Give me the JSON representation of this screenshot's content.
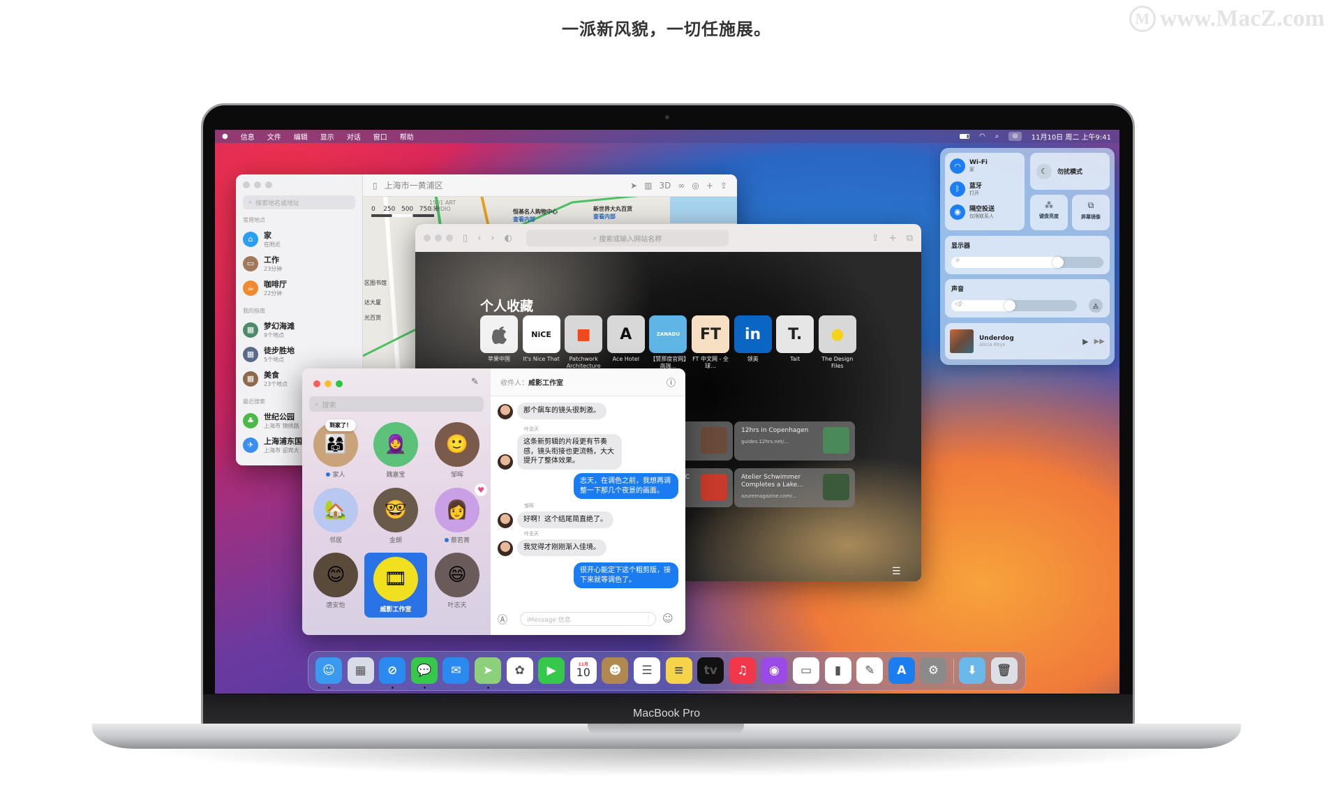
{
  "headline": "一派新风貌，一切任施展。",
  "watermark": "www.MacZ.com",
  "device_label": "MacBook Pro",
  "menubar": {
    "items": [
      "信息",
      "文件",
      "编辑",
      "显示",
      "对话",
      "窗口",
      "帮助"
    ],
    "datetime": "11月10日 周二 上午9:41"
  },
  "maps": {
    "search_placeholder": "搜索地名或地址",
    "location_title": "上海市一黄浦区",
    "toolbar_3d": "3D",
    "sections": [
      {
        "title": "常用地点",
        "items": [
          {
            "name": "家",
            "detail": "在附近",
            "color": "#2a9df4",
            "icon": "home-icon"
          },
          {
            "name": "工作",
            "detail": "23分钟",
            "color": "#a0785a",
            "icon": "briefcase-icon"
          },
          {
            "name": "咖啡厅",
            "detail": "22分钟",
            "color": "#f08a30",
            "icon": "coffee-icon"
          }
        ]
      },
      {
        "title": "我的指南",
        "items": [
          {
            "name": "梦幻海滩",
            "detail": "9个地点",
            "color": "#4c8a6a",
            "icon": "guide-icon"
          },
          {
            "name": "徒步胜地",
            "detail": "5个地点",
            "color": "#5a6a8a",
            "icon": "guide-icon"
          },
          {
            "name": "美食",
            "detail": "23个地点",
            "color": "#8a6a4a",
            "icon": "guide-icon"
          }
        ]
      },
      {
        "title": "最近搜索",
        "items": [
          {
            "name": "世纪公园",
            "detail": "上海市 锦绣路",
            "color": "#4cb848",
            "icon": "park-icon"
          },
          {
            "name": "上海浦东国",
            "detail": "上海市 迎宾大",
            "color": "#3a8ef0",
            "icon": "airplane-icon"
          }
        ]
      }
    ],
    "map_labels": {
      "scale": [
        "0",
        "250",
        "500",
        "750 米"
      ],
      "studio": "1501 ART STUDIO",
      "mall1": "恒基名人购物中心",
      "mall1_sub": "查看内部",
      "mall2": "新世界大丸百货",
      "mall2_sub": "查看内部",
      "library": "区图书馆",
      "building": "达大厦",
      "shop": "光百货"
    }
  },
  "safari": {
    "search_placeholder": "搜索或输入网站名称",
    "favorites_title": "个人收藏",
    "favorites": [
      {
        "label": "苹果中国",
        "glyph": "",
        "bg": "#f2f2f2",
        "fg": "#666"
      },
      {
        "label": "It's Nice That",
        "glyph": "NiCE",
        "bg": "#ffffff",
        "fg": "#111"
      },
      {
        "label": "Patchwork Architecture",
        "glyph": "■",
        "bg": "#d8d8d8",
        "fg": "#f04a1a"
      },
      {
        "label": "Ace Hotel",
        "glyph": "A",
        "bg": "#d8d8d8",
        "fg": "#111"
      },
      {
        "label": "【赞那度官网】高端...",
        "glyph": "ZANADU",
        "bg": "#5fb6e6",
        "fg": "#fff"
      },
      {
        "label": "FT 中文网 - 全球...",
        "glyph": "FT",
        "bg": "#f6dfc2",
        "fg": "#222"
      },
      {
        "label": "领英",
        "glyph": "in",
        "bg": "#0a66c2",
        "fg": "#fff"
      },
      {
        "label": "Tait",
        "glyph": "T.",
        "bg": "#e6e6e6",
        "fg": "#222"
      },
      {
        "label": "The Design Files",
        "glyph": "●",
        "bg": "#d8d8d8",
        "fg": "#f6d21a"
      }
    ],
    "sites": [
      {
        "title": "",
        "url": ""
      },
      {
        "title": "12hrs in Copenhagen",
        "url": "guides.12hrs.net/..."
      },
      {
        "title": "ONES WATC",
        "url": ""
      },
      {
        "title": "Atelier Schwimmer Completes a Lake...",
        "url": "azuremagazine.com/..."
      }
    ]
  },
  "messages": {
    "search_placeholder": "搜索",
    "to_label": "收件人：",
    "recipient": "威影工作室",
    "input_placeholder": "iMessage 信息",
    "contacts": [
      {
        "name": "家人",
        "unread": true,
        "bg": "#c9a37a",
        "glyph": "👨‍👩‍👧",
        "bubble": "到家了！"
      },
      {
        "name": "魏嘉宝",
        "bg": "#5cc27a",
        "glyph": "🧕"
      },
      {
        "name": "邹晖",
        "bg": "#7a5a4a",
        "glyph": "🙂"
      },
      {
        "name": "邻居",
        "bg": "#b8c8f0",
        "glyph": "🏡"
      },
      {
        "name": "金朗",
        "bg": "#6a5a4a",
        "glyph": "🤓"
      },
      {
        "name": "蔡若菁",
        "unread": true,
        "bg": "#c9a0e6",
        "glyph": "👩",
        "heart": true
      },
      {
        "name": "唐安怡",
        "bg": "#5a4a3a",
        "glyph": "😊"
      },
      {
        "name": "威影工作室",
        "selected": true,
        "bg": "#f0e020",
        "glyph": "🎞"
      },
      {
        "name": "叶志天",
        "bg": "#6a5a5a",
        "glyph": "😄"
      }
    ],
    "thread": [
      {
        "dir": "in",
        "sender": "",
        "text": "那个飙车的镜头很刺激。"
      },
      {
        "dir": "in",
        "sender": "叶志天",
        "text": "这条新剪辑的片段更有节奏感，镜头衔接也更流畅，大大提升了整体效果。"
      },
      {
        "dir": "out",
        "sender": "",
        "text": "志天，在调色之前，我想再调整一下那几个夜景的画面。"
      },
      {
        "dir": "in",
        "sender": "邹晖",
        "text": "好啊！这个结尾简直绝了。"
      },
      {
        "dir": "in",
        "sender": "叶志天",
        "text": "我觉得才刚刚渐入佳境。"
      },
      {
        "dir": "out",
        "sender": "",
        "text": "很开心能定下这个粗剪版，接下来就等调色了。"
      }
    ]
  },
  "control_center": {
    "wifi": {
      "title": "Wi-Fi",
      "status": "家"
    },
    "bluetooth": {
      "title": "蓝牙",
      "status": "打开"
    },
    "airdrop": {
      "title": "隔空投送",
      "status": "仅限联系人"
    },
    "dnd": "勿扰模式",
    "keyboard_brightness": "键盘亮度",
    "screen_mirroring": "屏幕镜像",
    "display": {
      "title": "显示器",
      "level": 0.73
    },
    "sound": {
      "title": "声音",
      "level": 0.5
    },
    "now_playing": {
      "title": "Underdog",
      "artist": "Alicia Keys"
    }
  },
  "dock": {
    "calendar_month": "11月",
    "calendar_day": "10",
    "apps": [
      {
        "name": "finder",
        "bg": "#3a9af0",
        "glyph": "☺",
        "running": true
      },
      {
        "name": "launchpad",
        "bg": "#d8dce6",
        "glyph": "▦"
      },
      {
        "name": "safari",
        "bg": "#2a8af0",
        "glyph": "⊘",
        "running": true
      },
      {
        "name": "messages",
        "bg": "#36c84a",
        "glyph": "💬",
        "running": true
      },
      {
        "name": "mail",
        "bg": "#2a8af0",
        "glyph": "✉"
      },
      {
        "name": "maps",
        "bg": "#8cd07a",
        "glyph": "➤",
        "running": true
      },
      {
        "name": "photos",
        "bg": "#ffffff",
        "glyph": "✿"
      },
      {
        "name": "facetime",
        "bg": "#36c84a",
        "glyph": "▶"
      },
      {
        "name": "calendar",
        "bg": "#ffffff",
        "glyph": ""
      },
      {
        "name": "contacts",
        "bg": "#b08850",
        "glyph": "☻"
      },
      {
        "name": "reminders",
        "bg": "#ffffff",
        "glyph": "☰"
      },
      {
        "name": "notes",
        "bg": "#f6d44a",
        "glyph": "≡"
      },
      {
        "name": "tv",
        "bg": "#111111",
        "glyph": "tv"
      },
      {
        "name": "music",
        "bg": "#f0384a",
        "glyph": "♫"
      },
      {
        "name": "podcasts",
        "bg": "#9a4ae6",
        "glyph": "◉"
      },
      {
        "name": "keynote",
        "bg": "#ffffff",
        "glyph": "▭"
      },
      {
        "name": "numbers",
        "bg": "#ffffff",
        "glyph": "▮"
      },
      {
        "name": "pages",
        "bg": "#ffffff",
        "glyph": "✎"
      },
      {
        "name": "app-store",
        "bg": "#1a7ef0",
        "glyph": "A"
      },
      {
        "name": "system-preferences",
        "bg": "#8a8a8a",
        "glyph": "⚙"
      },
      {
        "name": "downloads-folder",
        "bg": "#6ab8ea",
        "glyph": "⬇"
      },
      {
        "name": "trash",
        "bg": "#dcdfe6",
        "glyph": "🗑"
      }
    ]
  }
}
